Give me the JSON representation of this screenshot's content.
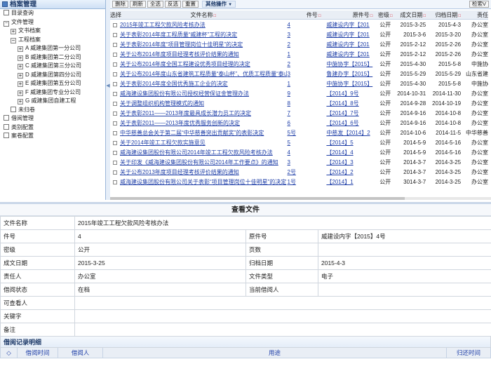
{
  "sidebar": {
    "title": "档案管理",
    "items": [
      {
        "label": "目录查询",
        "level": 0,
        "toggle": "box"
      },
      {
        "label": "文件管理",
        "level": 0,
        "toggle": "open"
      },
      {
        "label": "文书档案",
        "level": 1,
        "toggle": "plus"
      },
      {
        "label": "工程档案",
        "level": 1,
        "toggle": "minus"
      },
      {
        "label": "A 威建集团第一分公司",
        "level": 2,
        "toggle": "plus"
      },
      {
        "label": "B 威建集团第二分公司",
        "level": 2,
        "toggle": "plus"
      },
      {
        "label": "C 威建集团第三分公司",
        "level": 2,
        "toggle": "plus"
      },
      {
        "label": "D 威建集团第四分公司",
        "level": 2,
        "toggle": "plus"
      },
      {
        "label": "E 威建集团第五分公司",
        "level": 2,
        "toggle": "plus"
      },
      {
        "label": "F 威建集团专业分公司",
        "level": 2,
        "toggle": "plus"
      },
      {
        "label": "G 威建集团自建工程",
        "level": 2,
        "toggle": "plus"
      },
      {
        "label": "未归卷",
        "level": 1,
        "toggle": "box"
      },
      {
        "label": "借阅管理",
        "level": 0,
        "toggle": "box"
      },
      {
        "label": "类别配置",
        "level": 0,
        "toggle": "box"
      },
      {
        "label": "案卷配置",
        "level": 0,
        "toggle": "box"
      }
    ]
  },
  "toolbar": {
    "buttons": [
      "删除",
      "刷新",
      "全选",
      "反选",
      "重置"
    ],
    "more": "其他操作",
    "search": "检索V"
  },
  "grid": {
    "headers": [
      "选择",
      "文件名称",
      "件号",
      "原件号",
      "密级",
      "成文日期",
      "归档日期",
      "责任"
    ],
    "rows": [
      {
        "name": "2015年竣工工程欠款风险考核办法",
        "num": "4",
        "org": "威建设内字【201",
        "sec": "公开",
        "date": "2015-3-25",
        "adate": "2015-4-3",
        "dept": "办公室"
      },
      {
        "name": "关于表彰2014年度工程质量“威建杯”工程的决定",
        "num": "3",
        "org": "威建设内字【201",
        "sec": "公开",
        "date": "2015-3-6",
        "adate": "2015-3-20",
        "dept": "办公室"
      },
      {
        "name": "关于表彰2014年度“项目管理岗位十佳明星”的决定",
        "num": "2",
        "org": "威建设内字【201",
        "sec": "公开",
        "date": "2015-2-12",
        "adate": "2015-2-26",
        "dept": "办公室"
      },
      {
        "name": "关于公布2014年度项目经理考核评价结果的通知",
        "num": "1",
        "org": "威建设内字【201",
        "sec": "公开",
        "date": "2015-2-12",
        "adate": "2015-2-26",
        "dept": "办公室"
      },
      {
        "name": "关于公布2014年度全国工程建设优秀项目经理的决定",
        "num": "2",
        "org": "中施协字【2015】",
        "sec": "公开",
        "date": "2015-4-30",
        "adate": "2015-5-8",
        "dept": "中施协"
      },
      {
        "name": "关于公布2014年度山东省建筑工程质量“泰山杯”、优质工程质量“泰山杯”",
        "num": "3",
        "org": "鲁建办字【2015】",
        "sec": "公开",
        "date": "2015-5-29",
        "adate": "2015-5-29",
        "dept": "山东省建"
      },
      {
        "name": "关于表彰2014年度全国优秀施工企业的决定",
        "num": "1",
        "org": "中施协字【2015】",
        "sec": "公开",
        "date": "2015-4-30",
        "adate": "2015-5-8",
        "dept": "中施协"
      },
      {
        "name": "威海建设集团股份有限公司授权经营保证金管理办法",
        "num": "9",
        "org": "【2014】9号",
        "sec": "公开",
        "date": "2014-10-31",
        "adate": "2014-11-30",
        "dept": "办公室"
      },
      {
        "name": "关于调整组织机构管理模式的通知",
        "num": "8",
        "org": "【2014】8号",
        "sec": "公开",
        "date": "2014-9-28",
        "adate": "2014-10-19",
        "dept": "办公室"
      },
      {
        "name": "关于表彰2011——2013年度最具成长潜力员工的决定",
        "num": "7",
        "org": "【2014】7号",
        "sec": "公开",
        "date": "2014-9-16",
        "adate": "2014-10-8",
        "dept": "办公室"
      },
      {
        "name": "关于表彰2011——2013年度优秀服务创新的决定",
        "num": "6",
        "org": "【2014】6号",
        "sec": "公开",
        "date": "2014-9-16",
        "adate": "2014-10-8",
        "dept": "办公室"
      },
      {
        "name": "中华慈善总会关于第二届“中华慈善突出贡献奖”的表彰决定",
        "num": "5号",
        "org": "中慈发【2014】2",
        "sec": "公开",
        "date": "2014-10-6",
        "adate": "2014-11-5",
        "dept": "中华慈善"
      },
      {
        "name": "关于2014年竣工工程欠款实施意见",
        "num": "5",
        "org": "【2014】5",
        "sec": "公开",
        "date": "2014-5-9",
        "adate": "2014-5-16",
        "dept": "办公室"
      },
      {
        "name": "威海建设集团股份有限公司2014年竣工工程欠款风险考核办法",
        "num": "4",
        "org": "【2014】4",
        "sec": "公开",
        "date": "2014-5-9",
        "adate": "2014-5-16",
        "dept": "办公室"
      },
      {
        "name": "关于印发《威海建设集团股份有限公司2014年工作要点》的通知",
        "num": "3",
        "org": "【2014】3",
        "sec": "公开",
        "date": "2014-3-7",
        "adate": "2014-3-25",
        "dept": "办公室"
      },
      {
        "name": "关于公布2013年度项目经理考核评价结果的通知",
        "num": "2号",
        "org": "【2014】2",
        "sec": "公开",
        "date": "2014-3-7",
        "adate": "2014-3-25",
        "dept": "办公室"
      },
      {
        "name": "威海建设集团股份有限公司关于表彰“项目管理岗位十佳明星”的决定",
        "num": "1号",
        "org": "【2014】1",
        "sec": "公开",
        "date": "3014-3-7",
        "adate": "2014-3-25",
        "dept": "办公室"
      }
    ]
  },
  "detail": {
    "title": "查看文件",
    "file_name_label": "文件名称",
    "file_name": "2015年竣工工程欠款风险考核办法",
    "num_label": "件号",
    "num": "4",
    "orig_label": "原件号",
    "orig": "威建设内字【2015】4号",
    "sec_label": "密级",
    "sec": "公开",
    "pages_label": "页数",
    "pages": "",
    "date_label": "成文日期",
    "date": "2015-3-25",
    "adate_label": "归档日期",
    "adate": "2015-4-3",
    "resp_label": "责任人",
    "resp": "办公室",
    "type_label": "文件类型",
    "type": "电子",
    "status_label": "借阅状态",
    "status": "在档",
    "borrower_label": "当前借阅人",
    "borrower": "",
    "viewers_label": "可查看人",
    "keywords_label": "关键字",
    "notes_label": "备注"
  },
  "borrow": {
    "title": "借阅记录明细",
    "cols": [
      "◇",
      "借阅时间",
      "借阅人",
      "用途",
      "归还时间"
    ]
  }
}
